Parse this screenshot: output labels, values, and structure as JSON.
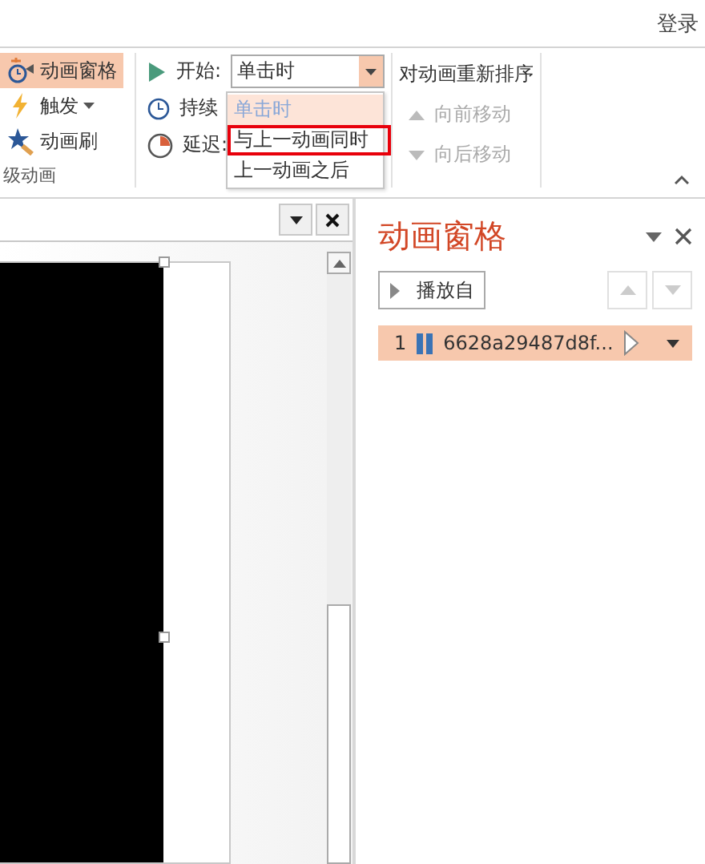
{
  "top_bar": {
    "sign_in": "登录"
  },
  "advanced_group": {
    "label": "级动画",
    "items": [
      {
        "label": "动画窗格",
        "kind": "pane",
        "selected": true,
        "dropdown": false
      },
      {
        "label": "触发",
        "kind": "trigger",
        "selected": false,
        "dropdown": true
      },
      {
        "label": "动画刷",
        "kind": "painter",
        "selected": false,
        "dropdown": false
      }
    ]
  },
  "timing_group": {
    "start_label": "开始:",
    "start_value": "单击时",
    "duration_label": "持续",
    "delay_label": "延迟:",
    "menu": [
      {
        "label": "单击时",
        "selected": true,
        "outlined": false
      },
      {
        "label": "与上一动画同时",
        "selected": false,
        "outlined": true
      },
      {
        "label": "上一动画之后",
        "selected": false,
        "outlined": false
      }
    ]
  },
  "reorder_group": {
    "title": "对动画重新排序",
    "items": [
      {
        "label": "向前移动",
        "kind": "up",
        "disabled": true
      },
      {
        "label": "向后移动",
        "kind": "down",
        "disabled": true
      }
    ]
  },
  "animation_pane": {
    "title": "动画窗格",
    "play_from": "播放自",
    "reorder_disabled": true,
    "items": [
      {
        "number": "1",
        "name": "6628a29487d8f...",
        "selected": true
      }
    ]
  }
}
